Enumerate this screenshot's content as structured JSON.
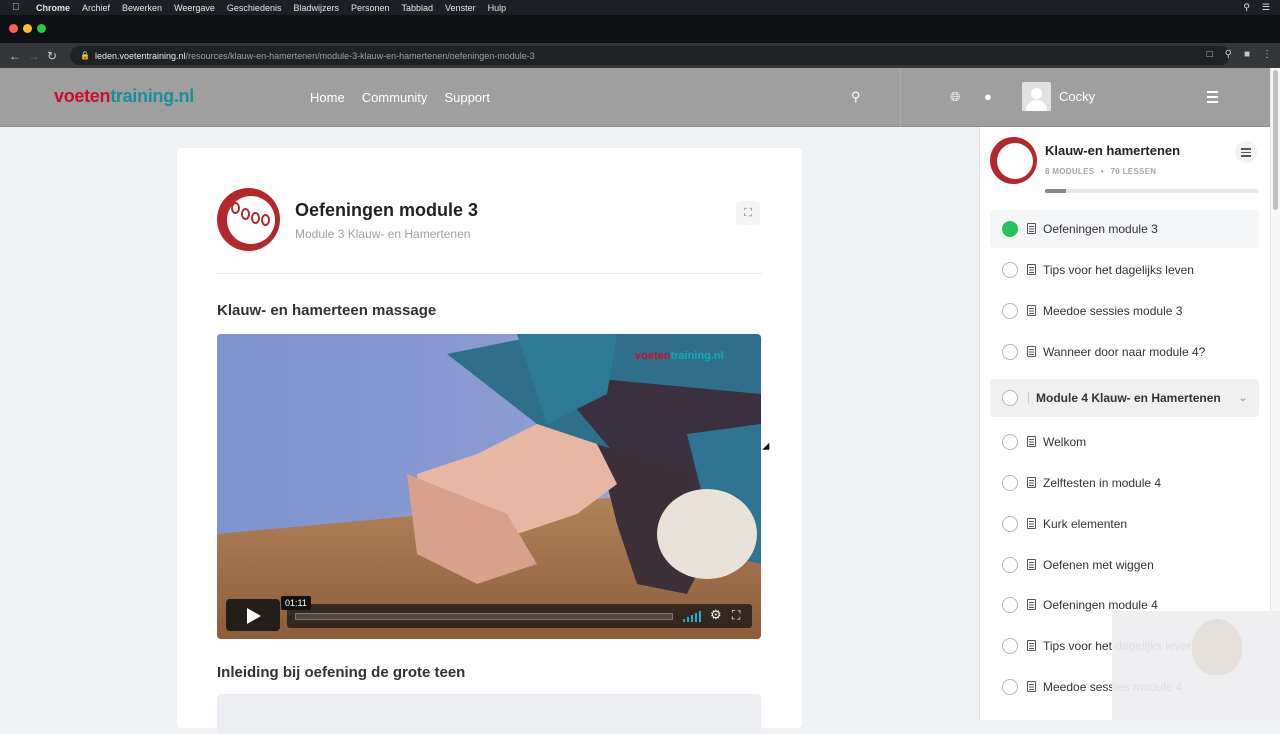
{
  "menubar": {
    "app": "Chrome",
    "items": [
      "Archief",
      "Bewerken",
      "Weergave",
      "Geschiedenis",
      "Bladwijzers",
      "Personen",
      "Tabblad",
      "Venster",
      "Hulp"
    ]
  },
  "browser": {
    "url_host": "leden.voetentraining.nl",
    "url_path": "/resources/klauw-en-hamertenen/module-3-klauw-en-hamertenen/oefeningen-module-3"
  },
  "site": {
    "logo_part1": "voeten",
    "logo_part2": "training.nl",
    "nav": [
      "Home",
      "Community",
      "Support"
    ],
    "username": "Cocky"
  },
  "lesson": {
    "title": "Oefeningen module 3",
    "subtitle": "Module 3 Klauw- en Hamertenen",
    "section1": "Klauw- en hamerteen massage",
    "section2": "Inleiding bij oefening de grote teen",
    "video": {
      "time": "01:11",
      "watermark_part1": "voeten",
      "watermark_part2": "training.nl"
    }
  },
  "course": {
    "title": "Klauw-en hamertenen",
    "modules": "8 MODULES",
    "lessons": "70 LESSEN",
    "progress": 0.1,
    "items": [
      {
        "label": "Oefeningen module 3",
        "status": "done",
        "kind": "lesson"
      },
      {
        "label": "Tips voor het dagelijks leven",
        "status": "open",
        "kind": "lesson"
      },
      {
        "label": "Meedoe sessies module 3",
        "status": "open",
        "kind": "lesson"
      },
      {
        "label": "Wanneer door naar module 4?",
        "status": "open",
        "kind": "lesson"
      },
      {
        "label": "Module 4 Klauw- en Hamertenen",
        "status": "open",
        "kind": "module"
      },
      {
        "label": "Welkom",
        "status": "open",
        "kind": "lesson"
      },
      {
        "label": "Zelftesten in module 4",
        "status": "open",
        "kind": "lesson"
      },
      {
        "label": "Kurk elementen",
        "status": "open",
        "kind": "lesson"
      },
      {
        "label": "Oefenen met wiggen",
        "status": "open",
        "kind": "lesson"
      },
      {
        "label": "Oefeningen module 4",
        "status": "open",
        "kind": "lesson"
      },
      {
        "label": "Tips voor het dagelijks leven",
        "status": "open",
        "kind": "lesson"
      },
      {
        "label": "Meedoe sessies module 4",
        "status": "open",
        "kind": "lesson"
      }
    ]
  }
}
